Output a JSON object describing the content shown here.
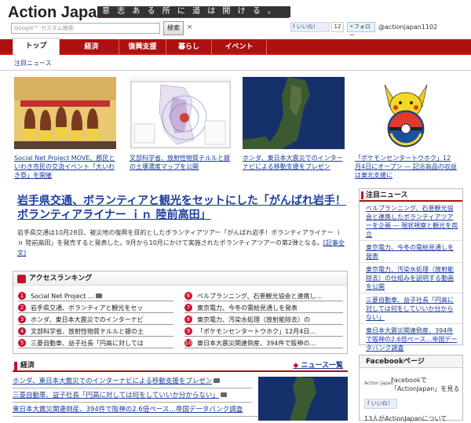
{
  "header": {
    "logo_main": "Action Japan",
    "logo_bang": "!",
    "tagline": "意 志 あ る 所 に 道 は 開 け る 。",
    "search_placeholder": "Google™ カスタム検索",
    "search_button": "検索",
    "clear": "×",
    "fb_like": "いいね！",
    "fb_count": "12",
    "tw_follow": "フォロー",
    "tw_handle": "@actionjapan1102"
  },
  "nav": {
    "tabs": [
      "トップ",
      "経済",
      "復興支援",
      "暮らし",
      "イベント"
    ],
    "sub": "注目ニュース"
  },
  "pics": [
    {
      "caption": "Social Net Project MOVE、郡民といわき市民の交流イベント「大いわき祭」を開催"
    },
    {
      "caption": "文部科学省、放射性物質テルルと銀の土壌濃度マップを公開"
    },
    {
      "caption": "ホンダ、東日本大震災でのインターナビによる移動支援をプレゼン"
    },
    {
      "caption": "「ポケモンセンタートウホク」12月4日にオープン ― 記念商品の収益は東北支援に"
    }
  ],
  "headline": {
    "title": "岩手県交通、ボランティアと観光をセットにした「がんばれ岩手！ボランティアライナー ｉｎ 陸前高田」",
    "lead": "岩手県交通は10月28日、被災地の復興を目的としたボランティアツアー「がんばれ岩手！ボランティアライナー ｉｎ 陸前高田」を発売すると発表した。9月から10月にかけて実施されたボランティアツアーの第2弾となる。",
    "more": "[記事全文]"
  },
  "ranking": {
    "title": "アクセスランキング",
    "items": [
      {
        "num": "1",
        "text": "Social Net Project …"
      },
      {
        "num": "2",
        "text": "岩手県交通、ボランティアと観光をセッ"
      },
      {
        "num": "3",
        "text": "ホンダ、東日本大震災でのインターナビ"
      },
      {
        "num": "4",
        "text": "文部科学省、放射性物質テルルと銀の土"
      },
      {
        "num": "5",
        "text": "三菱自動車、益子社長「円高に対しては"
      },
      {
        "num": "6",
        "text": "ペルプランニング、石巻観光協会と連携し…"
      },
      {
        "num": "7",
        "text": "東京電力、今冬の需給見通しを発表"
      },
      {
        "num": "8",
        "text": "東京電力、汚染水処理（放射能除去）の"
      },
      {
        "num": "9",
        "text": "「ポケモンセンタートウホク」12月4日…"
      },
      {
        "num": "10",
        "text": "東日本大震災関連倒産、394件で阪神の…"
      }
    ]
  },
  "economy": {
    "title": "経済",
    "more": "ニュース一覧",
    "items": [
      "ホンダ、東日本大震災でのインターナビによる移動支援をプレゼン",
      "三菱自動車、益子社長「円高に対しては何をしていいか分からない」",
      "東日本大震災関連倒産、394件で阪神の2.6倍ペース…帝国データバンク調査"
    ]
  },
  "side": {
    "title": "注目ニュース",
    "items": [
      "ペルプランニング、石巻観光協会と連携したボランティアツアーを企画 ― 現状視察と観光を両立",
      "東京電力、今冬の需給見通しを発表",
      "東京電力、汚染水処理（放射能除去）の仕組みを説明する動画を公開",
      "三菱自動車、益子社長「円高に対しては何をしていいか分からない」",
      "東日本大震災関連倒産、394件で阪神の2.6倍ペース…帝国データバンク調査"
    ]
  },
  "facebook": {
    "title": "Facebookページ",
    "small": "Action Japan",
    "text": "Facebookで「ActionJapan」を見る",
    "like": "いいね！",
    "bottom": "13人がActionJapanについて"
  },
  "colors": {
    "brand_red": "#b01010",
    "link_blue": "#1a3c9c"
  }
}
